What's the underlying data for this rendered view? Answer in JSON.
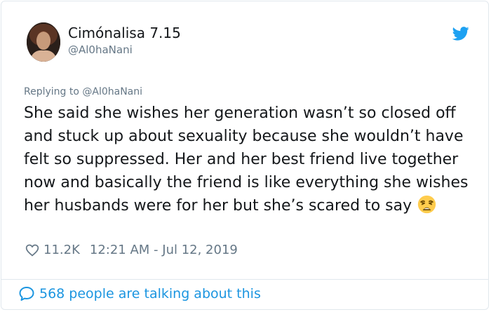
{
  "user": {
    "display_name": "Cimónalisa 7.15",
    "handle": "@Al0haNani"
  },
  "reply_context": "Replying to @Al0haNani",
  "tweet": {
    "text": "She said she wishes her generation wasn’t so closed off and stuck up about sexuality because she wouldn’t have felt so suppressed. Her and her best friend live together now and basically the friend is like everything she wishes her husbands were for her but she’s scared to say",
    "emoji": "weary-face"
  },
  "meta": {
    "likes": "11.2K",
    "timestamp": "12:21 AM - Jul 12, 2019"
  },
  "footer": {
    "talking_label": "568 people are talking about this"
  },
  "icons": {
    "bird": "twitter-bird-icon",
    "like": "heart-icon",
    "comment": "speech-bubble-icon"
  },
  "colors": {
    "accent": "#1da1f2",
    "link": "#1b95e0",
    "muted": "#657786",
    "text": "#14171a"
  }
}
